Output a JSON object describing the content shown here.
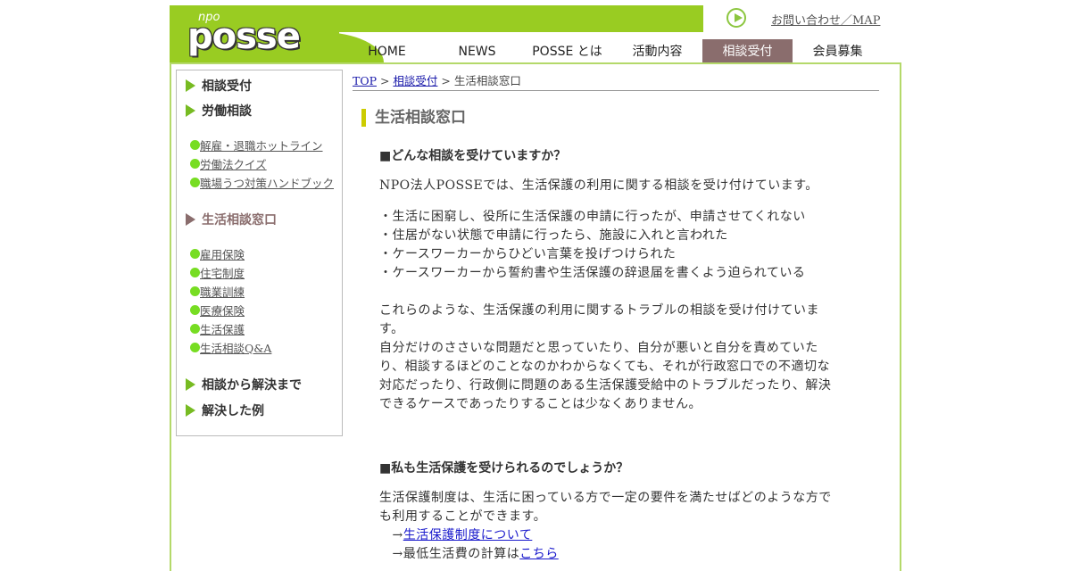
{
  "logo": {
    "small": "npo",
    "main": "posse"
  },
  "header": {
    "contact_link": "お問い合わせ／MAP"
  },
  "nav": [
    "HOME",
    "NEWS",
    "POSSE とは",
    "活動内容",
    "相談受付",
    "会員募集"
  ],
  "nav_active_index": 4,
  "sidebar": {
    "h1": "相談受付",
    "h2": "労働相談",
    "labor_links": [
      "解雇・退職ホットライン",
      "労働法クイズ",
      "職場うつ対策ハンドブック"
    ],
    "h3": "生活相談窓口",
    "life_links": [
      "雇用保険",
      "住宅制度",
      "職業訓練",
      "医療保険",
      "生活保護",
      "生活相談Q&A"
    ],
    "h4": "相談から解決まで",
    "h5": "解決した例"
  },
  "breadcrumb": {
    "top": "TOP",
    "sep1": " > ",
    "consult": "相談受付",
    "sep2": " > ",
    "current": "生活相談窓口"
  },
  "main": {
    "title": "生活相談窓口",
    "q1": "■どんな相談を受けていますか？",
    "p1": "NPO法人POSSEでは、生活保護の利用に関する相談を受け付けています。",
    "bullets": [
      "・生活に困窮し、役所に生活保護の申請に行ったが、申請させてくれない",
      "・住居がない状態で申請に行ったら、施設に入れと言われた",
      "・ケースワーカーからひどい言葉を投げつけられた",
      "・ケースワーカーから誓約書や生活保護の辞退届を書くよう迫られている"
    ],
    "p2_lines": [
      "これらのような、生活保護の利用に関するトラブルの相談を受け付けていま",
      "す。",
      "自分だけのささいな問題だと思っていたり、自分が悪いと自分を責めていた",
      "り、相談するほどのことなのかわからなくても、それが行政窓口での不適切な",
      "対応だったり、行政側に問題のある生活保護受給中のトラブルだったり、解決",
      "できるケースであったりすることは少なくありません。"
    ],
    "q2": "■私も生活保護を受けられるのでしょうか？",
    "p3_lines": [
      "生活保護制度は、生活に困っている方で一定の要件を満たせばどのような方で",
      "も利用することができます。"
    ],
    "link1_arrow": "　→",
    "link1_text": "生活保護制度について",
    "link2_arrow": "　→最低生活費の計算は",
    "link2_text": "こちら"
  },
  "colors": {
    "accent_green": "#99cc22",
    "active_nav": "#8a6d6d",
    "title_bar": "#cccc00"
  }
}
